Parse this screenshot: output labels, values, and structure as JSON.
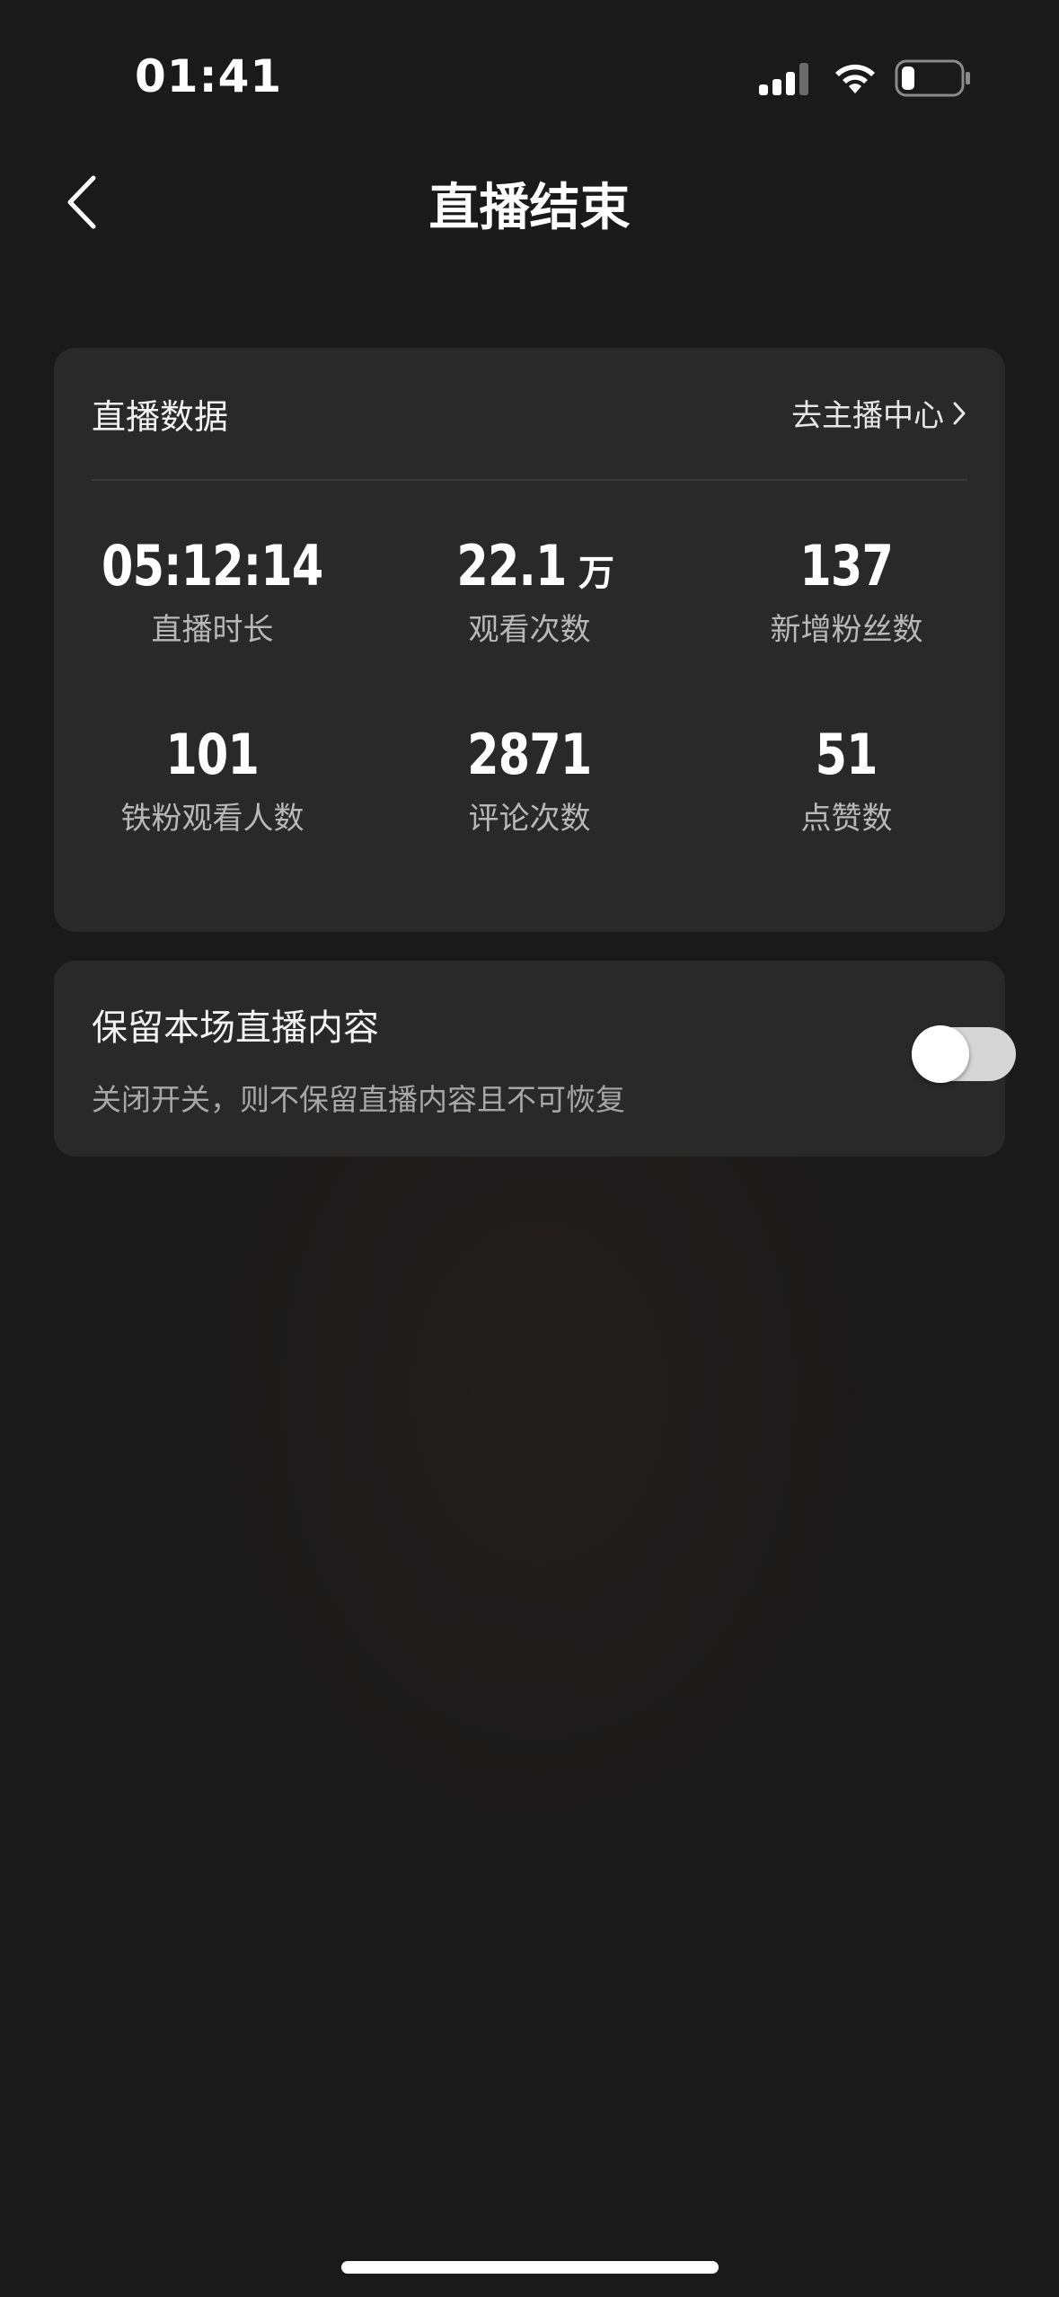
{
  "status_bar": {
    "time": "01:41"
  },
  "nav": {
    "title": "直播结束",
    "back_icon": "chevron-left-icon"
  },
  "stats_card": {
    "title": "直播数据",
    "host_center_link": "去主播中心",
    "stats": [
      {
        "value": "05:12:14",
        "unit": "",
        "label": "直播时长"
      },
      {
        "value": "22.1",
        "unit": "万",
        "label": "观看次数"
      },
      {
        "value": "137",
        "unit": "",
        "label": "新增粉丝数"
      },
      {
        "value": "101",
        "unit": "",
        "label": "铁粉观看人数"
      },
      {
        "value": "2871",
        "unit": "",
        "label": "评论次数"
      },
      {
        "value": "51",
        "unit": "",
        "label": "点赞数"
      }
    ]
  },
  "keep_card": {
    "title": "保留本场直播内容",
    "description": "关闭开关，则不保留直播内容且不可恢复",
    "toggle_on": false
  },
  "colors": {
    "background": "#1b1a1a",
    "card": "#2a2929",
    "toggle_track": "#d6d6d6"
  }
}
